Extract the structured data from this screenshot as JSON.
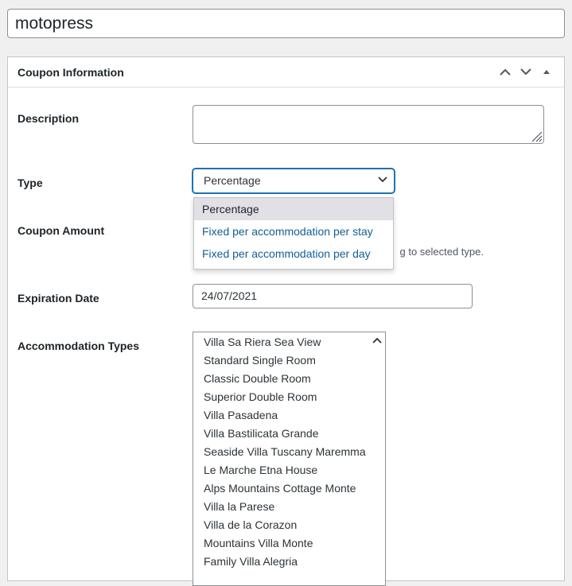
{
  "title": {
    "value": "motopress"
  },
  "metabox": {
    "title": "Coupon Information"
  },
  "fields": {
    "description": {
      "label": "Description",
      "value": ""
    },
    "type": {
      "label": "Type",
      "selected": "Percentage",
      "options": [
        "Percentage",
        "Fixed per accommodation per stay",
        "Fixed per accommodation per day"
      ]
    },
    "amount": {
      "label": "Coupon Amount",
      "help_visible": "g to selected type."
    },
    "expiration": {
      "label": "Expiration Date",
      "value": "24/07/2021"
    },
    "accommodation_types": {
      "label": "Accommodation Types",
      "items": [
        "Villa Sa Riera Sea View",
        "Standard Single Room",
        "Classic Double Room",
        "Superior Double Room",
        "Villa Pasadena",
        "Villa Bastilicata Grande",
        "Seaside Villa Tuscany Maremma",
        "Le Marche Etna House",
        "Alps Mountains Cottage Monte",
        "Villa la Parese",
        "Villa de la Corazon",
        "Mountains Villa Monte",
        "Family Villa Alegria"
      ]
    }
  },
  "colors": {
    "accent": "#2271b1",
    "link": "#135e96",
    "selected_bg": "#e0e0e6"
  },
  "icons": {
    "move_up": "chevron-up-icon",
    "move_down": "chevron-down-icon",
    "toggle": "triangle-up-icon",
    "select_arrow": "chevron-down-icon",
    "scroll_up": "chevron-up-icon"
  }
}
